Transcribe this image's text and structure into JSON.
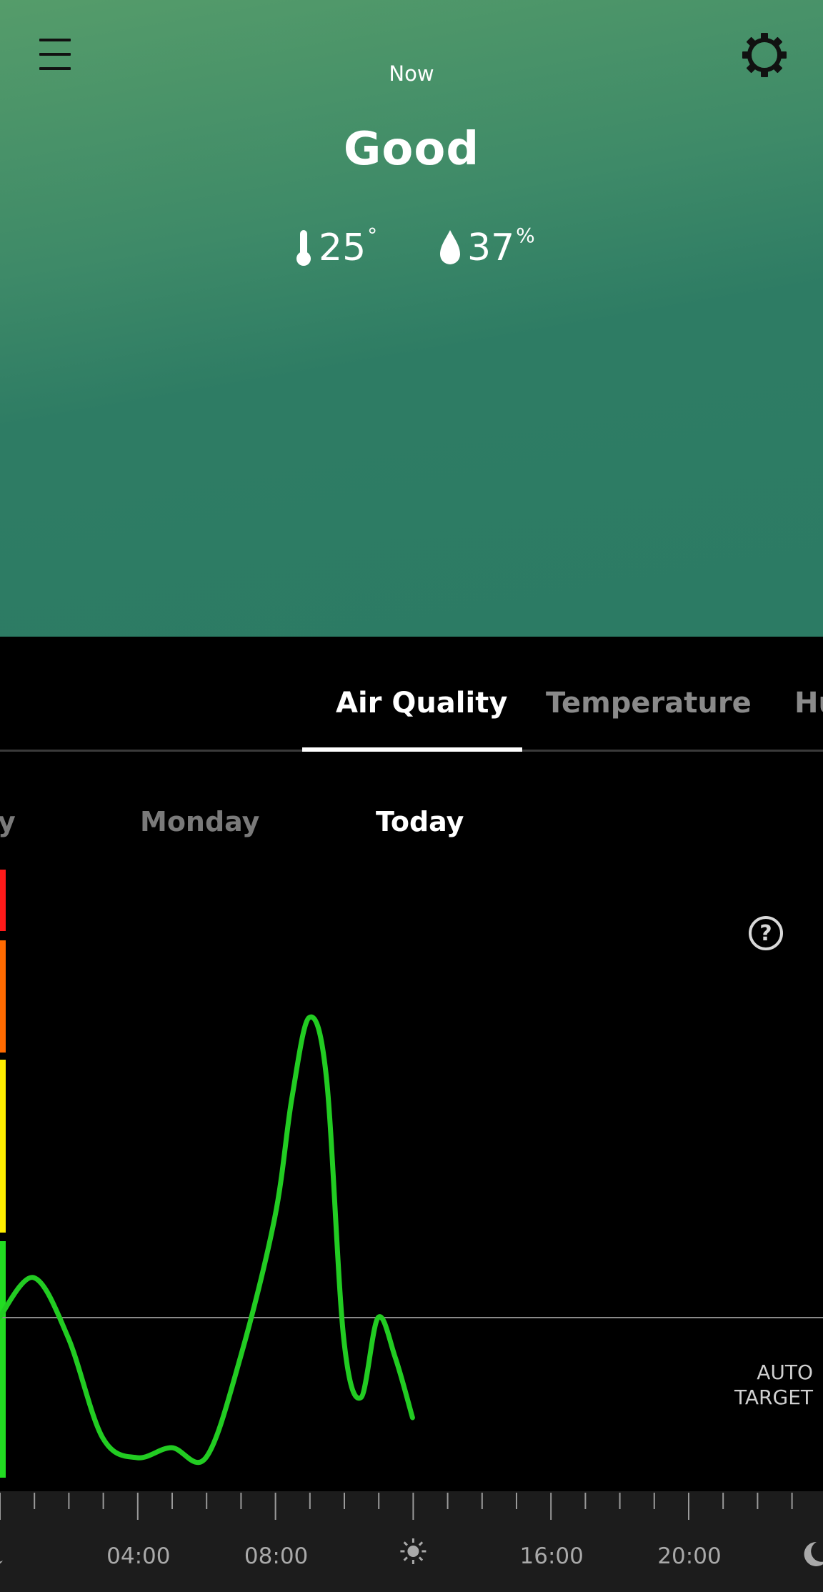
{
  "header": {
    "now_label": "Now",
    "status": "Good",
    "temperature": {
      "value": "25",
      "unit": "°",
      "icon": "thermometer-icon"
    },
    "humidity": {
      "value": "37",
      "unit": "%",
      "icon": "droplet-icon"
    },
    "menu_icon": "hamburger-menu-icon",
    "settings_icon": "gear-icon",
    "colors": {
      "gradient_top": "#559c6a",
      "gradient_bottom": "#2c7b64"
    }
  },
  "tabs": [
    {
      "label": "Air Quality",
      "active": true
    },
    {
      "label": "Temperature",
      "active": false
    },
    {
      "label": "Hu",
      "active": false
    }
  ],
  "days": [
    {
      "label": "y",
      "active": false
    },
    {
      "label": "Monday",
      "active": false
    },
    {
      "label": "Today",
      "active": true
    }
  ],
  "help_icon": "question-circle-icon",
  "auto_target": {
    "line1": "AUTO",
    "line2": "TARGET"
  },
  "chart_data": {
    "type": "line",
    "x_ticks": [
      "04:00",
      "08:00",
      "16:00",
      "20:00"
    ],
    "x_tick_icons": [
      "moon-icon",
      "sun-icon",
      "moon-icon"
    ],
    "scale_colors": [
      "#ff1a1a",
      "#ff6a00",
      "#ffee00",
      "#22dd22"
    ],
    "series": [
      {
        "color": "#22cc22",
        "x_hours": [
          0,
          1,
          2,
          3,
          4,
          5,
          6,
          7,
          8,
          8.5,
          9,
          9.5,
          10,
          10.5,
          11,
          11.5,
          12
        ],
        "values": [
          8,
          10,
          7,
          2,
          1,
          1.5,
          1,
          6,
          13,
          19,
          23,
          20,
          7,
          4,
          8,
          6,
          3
        ]
      }
    ],
    "auto_target_value": 8
  }
}
